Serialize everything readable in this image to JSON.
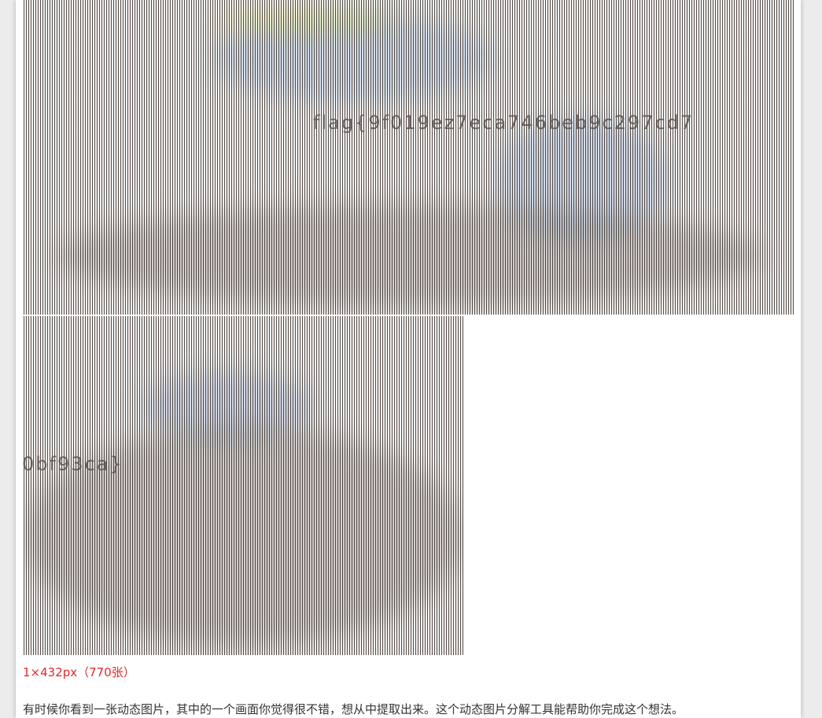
{
  "frames": [
    {
      "name": "gif-frame-1",
      "overlay_text": "flag{9f019ez7eca746beb9c297cd7"
    },
    {
      "name": "gif-frame-2",
      "overlay_text": "0bf93ca}"
    }
  ],
  "caption": "1×432px（770张）",
  "description": "有时候你看到一张动态图片，其中的一个画面你觉得很不错，想从中提取出来。这个动态图片分解工具能帮助你完成这个想法。",
  "colors": {
    "caption": "#e8262a",
    "body_text": "#333333",
    "page_background": "#ffffff",
    "outer_background": "#ececec"
  }
}
